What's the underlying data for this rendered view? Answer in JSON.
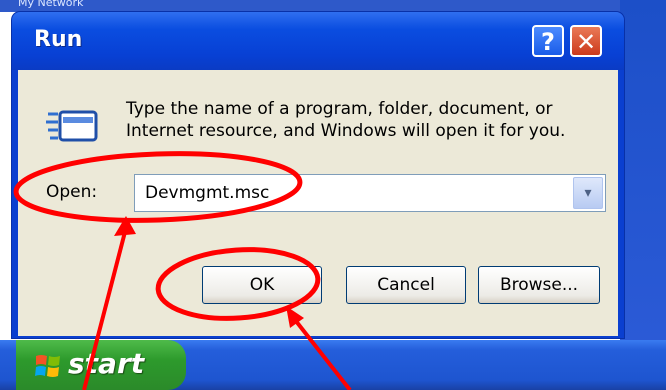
{
  "desktop": {
    "partial_label": "My Network"
  },
  "dialog": {
    "title": "Run",
    "help_button": "?",
    "close_button": "✕",
    "description": "Type the name of a program, folder, document, or Internet resource, and Windows will open it for you.",
    "open_label": "Open:",
    "open_value": "Devmgmt.msc",
    "ok_label": "OK",
    "cancel_label": "Cancel",
    "browse_label": "Browse..."
  },
  "taskbar": {
    "start_label": "start"
  },
  "annotations": {
    "color": "#ff0000"
  }
}
